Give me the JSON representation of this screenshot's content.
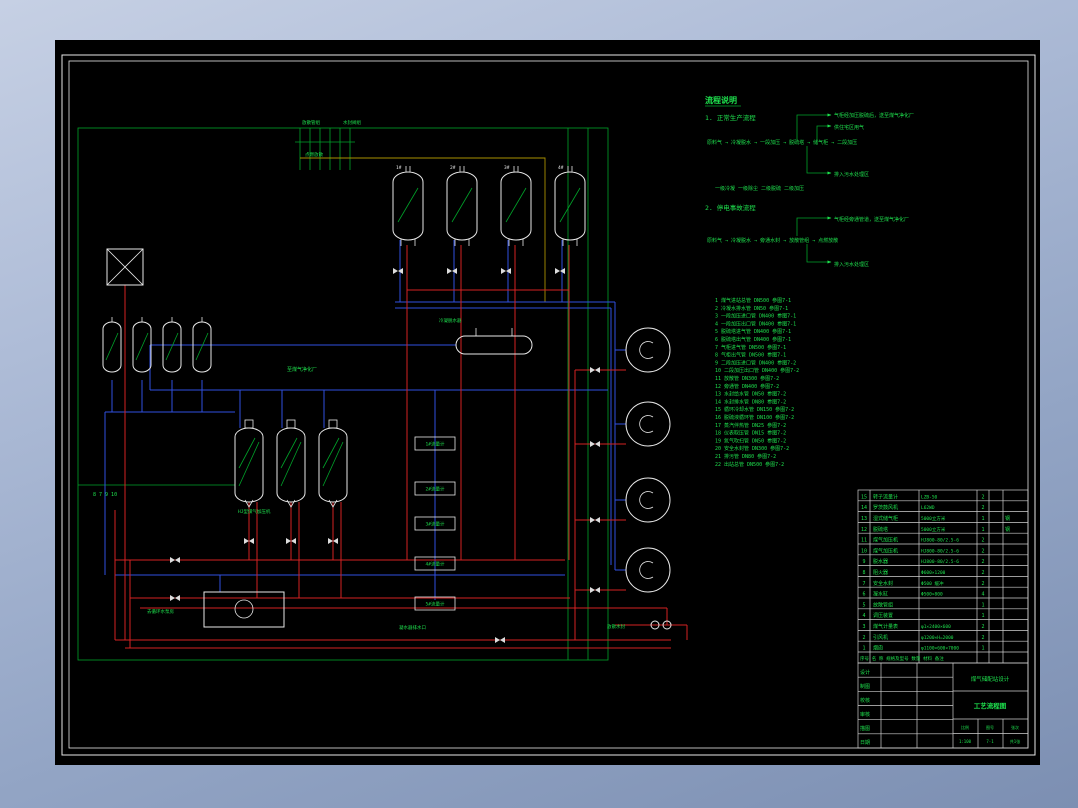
{
  "colors": {
    "pipe_red": "#d42222",
    "pipe_blue": "#3050e0",
    "line_green": "#00a32a",
    "text_green": "#1ee24e",
    "pipe_yellow": "#a89000",
    "frame_white": "#e8e8e8",
    "paper": "#000000",
    "bg_top": "#c6d0e4",
    "bg_bottom": "#7c8fb2"
  },
  "flow_notes": {
    "title": "流程说明",
    "s1_heading": "1. 正常生产流程",
    "s1_branch1": "气柜经加压脱硫后，送至煤气净化厂",
    "s1_branch2": "供住宅区用气",
    "s1_main": "原料气 → 冷凝脱水 → 一段加压 → 脱硫塔 → 储气柜 → 二段加压",
    "s1_branch3": "排入污水处理区",
    "s1_legend": "一级冷凝  一级除尘  二级脱硫  二级加压",
    "s2_heading": "2. 停电事故流程",
    "s2_branch1": "气柜经旁通管道，送至煤气净化厂",
    "s2_main": "原料气 → 冷凝脱水 → 旁通水封 → 放散管组 → 点燃放散",
    "s2_branch3": "排入污水处理区"
  },
  "pipes": {
    "rows": [
      "1  煤气进站总管 DN500      参图7-1",
      "2  冷凝水排水管 DN50       参图7-1",
      "3  一段加压进口管 DN400    参图7-1",
      "4  一段加压出口管 DN400    参图7-1",
      "5  脱硫塔进气管 DN400      参图7-1",
      "6  脱硫塔出气管 DN400      参图7-1",
      "7  气柜进气管 DN500        参图7-1",
      "8  气柜出气管 DN500        参图7-1",
      "9  二段加压进口管 DN400    参图7-2",
      "10 二段加压出口管 DN400    参图7-2",
      "11 放散管 DN300            参图7-2",
      "12 旁通管 DN400            参图7-2",
      "13 水封给水管 DN50         参图7-2",
      "14 水封排水管 DN80         参图7-2",
      "15 循环冷却水管 DN150      参图7-2",
      "16 脱硫液循环管 DN100      参图7-2",
      "17 蒸汽伴热管 DN25         参图7-2",
      "18 仪表取压管 DN15         参图7-2",
      "19 氮气吹扫管 DN50         参图7-2",
      "20 安全水封管 DN300        参图7-2",
      "21 排污管 DN80             参图7-2",
      "22 出站总管 DN500          参图7-2"
    ]
  },
  "instruments": [
    "1#流量计",
    "2#流量计",
    "3#流量计",
    "4#流量计",
    "5#流量计"
  ],
  "labels": [
    "放散管组",
    "水封阀组",
    "点燃放散",
    "至煤气净化厂",
    "8  7  9  10",
    "HJ型煤气加压机",
    "去循环水泵房",
    "凝水器排水口",
    "放散水封",
    "冷凝脱水器",
    "1#",
    "2#",
    "3#",
    "4#"
  ],
  "bom": {
    "header": "序号  名 称      规格及型号      数量 材料 备注",
    "rows": [
      {
        "no": "15",
        "name": "转子流量计",
        "spec": "LZB-50",
        "qty": "2",
        "note": ""
      },
      {
        "no": "14",
        "name": "罗茨鼓风机",
        "spec": "L62WD",
        "qty": "2",
        "note": ""
      },
      {
        "no": "13",
        "name": "湿式储气柜",
        "spec": "5000立方米",
        "qty": "1",
        "note": "钢"
      },
      {
        "no": "12",
        "name": "脱硫塔",
        "spec": "5000立方米",
        "qty": "1",
        "note": "钢"
      },
      {
        "no": "11",
        "name": "煤气加压机",
        "spec": "HJ800-80/2.5-6",
        "qty": "2",
        "note": ""
      },
      {
        "no": "10",
        "name": "煤气加压机",
        "spec": "HJ800-80/2.5-6",
        "qty": "2",
        "note": ""
      },
      {
        "no": "9",
        "name": "脱水器",
        "spec": "HJ800-80/2.5-6",
        "qty": "2",
        "note": ""
      },
      {
        "no": "8",
        "name": "阻火器",
        "spec": "Φ600×1200",
        "qty": "2",
        "note": ""
      },
      {
        "no": "7",
        "name": "安全水封",
        "spec": "Φ500 缓冲",
        "qty": "2",
        "note": ""
      },
      {
        "no": "6",
        "name": "凝水缸",
        "spec": "Φ500×800",
        "qty": "4",
        "note": ""
      },
      {
        "no": "5",
        "name": "放散管组",
        "spec": "",
        "qty": "1",
        "note": ""
      },
      {
        "no": "4",
        "name": "调压装置",
        "spec": "",
        "qty": "1",
        "note": ""
      },
      {
        "no": "3",
        "name": "煤气计量表",
        "spec": "φ1×2400×600",
        "qty": "2",
        "note": ""
      },
      {
        "no": "2",
        "name": "引风机",
        "spec": "φ1200×H=2000",
        "qty": "2",
        "note": ""
      },
      {
        "no": "1",
        "name": "烟囱",
        "spec": "φ1100×600×7000",
        "qty": "1",
        "note": ""
      }
    ]
  },
  "title_block": {
    "left_rows": [
      "设计",
      "制图",
      "校核",
      "审核",
      "描图",
      "日期"
    ],
    "project": "煤气储配站设计",
    "drawing": "工艺流程图",
    "cells_top": [
      "比例",
      "图号",
      "张次"
    ],
    "cells_bottom": [
      "1:100",
      "7-1",
      "共1张"
    ]
  }
}
